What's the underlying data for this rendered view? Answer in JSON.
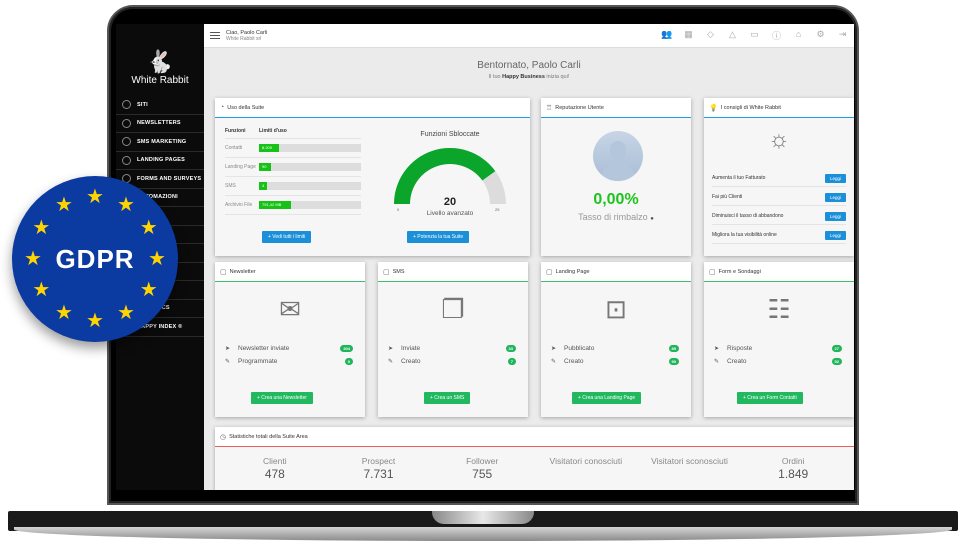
{
  "app": {
    "brand": "White Rabbit"
  },
  "header": {
    "greeting": "Ciao, Paolo Carli",
    "company": "White Rabbit srl",
    "icons": [
      "users-icon",
      "calendar-icon",
      "tag-icon",
      "bell-icon",
      "archive-icon",
      "help-icon",
      "lock-icon",
      "gear-icon",
      "logout-icon"
    ]
  },
  "sidebar": {
    "items": [
      {
        "label": "SITI",
        "icon": "globe-icon"
      },
      {
        "label": "NEWSLETTERS",
        "icon": "newsletter-icon"
      },
      {
        "label": "SMS MARKETING",
        "icon": "sms-icon"
      },
      {
        "label": "LANDING PAGES",
        "icon": "landing-icon"
      },
      {
        "label": "FORMS AND SURVEYS",
        "icon": "form-icon"
      },
      {
        "label": "AUTOMAZIONI",
        "icon": "automation-icon"
      },
      {
        "label": "",
        "icon": "item-icon"
      },
      {
        "label": "",
        "icon": "item-icon"
      },
      {
        "label": "",
        "icon": "item-icon"
      },
      {
        "label": "",
        "icon": "item-icon"
      },
      {
        "label": "",
        "icon": "item-icon"
      },
      {
        "label": "ANALYTICS",
        "icon": "analytics-icon"
      },
      {
        "label": "HAPPY INDEX ®",
        "icon": "happy-icon"
      }
    ]
  },
  "welcome": {
    "title": "Bentornato, Paolo Carli",
    "sub_pre": "Il tuo ",
    "sub_bold": "Happy Business",
    "sub_post": " inizia qui!"
  },
  "suite": {
    "title": "Uso della Suite",
    "col_func": "Funzioni",
    "col_limits": "Limiti d'uso",
    "rows": [
      {
        "label": "Contatti",
        "value": "8.209",
        "fraction": 0.2
      },
      {
        "label": "Landing Page",
        "value": "90",
        "fraction": 0.12
      },
      {
        "label": "SMS",
        "value": "4",
        "fraction": 0.08
      },
      {
        "label": "Archivio File",
        "value": "791,42 MB",
        "fraction": 0.31
      }
    ],
    "limits_button": "+ Vedi tutti i limiti",
    "gauge_title": "Funzioni Sbloccate",
    "gauge_value": 20,
    "gauge_min": 0,
    "gauge_max": 25,
    "gauge_label": "Livello avanzato",
    "upgrade_button": "+ Potenzia la tua Suite"
  },
  "reputation": {
    "title": "Reputazione Utente",
    "rate": "0,00%",
    "rate_label": "Tasso di rimbalzo"
  },
  "tips": {
    "title": "I consigli di White Rabbit",
    "items": [
      {
        "text": "Aumenta il tuo Fatturato",
        "button": "Leggi"
      },
      {
        "text": "Fai più Clienti",
        "button": "Leggi"
      },
      {
        "text": "Diminuisci il tasso di abbandono",
        "button": "Leggi"
      },
      {
        "text": "Migliora la tua visibilità online",
        "button": "Leggi"
      }
    ]
  },
  "modules": [
    {
      "title": "Newsletter",
      "rows": [
        {
          "label": "Newsletter inviate",
          "value": "204"
        },
        {
          "label": "Programmate",
          "value": "0"
        }
      ],
      "button": "+ Crea una Newsletter"
    },
    {
      "title": "SMS",
      "rows": [
        {
          "label": "Inviate",
          "value": "33"
        },
        {
          "label": "Creato",
          "value": "7"
        }
      ],
      "button": "+ Crea un SMS"
    },
    {
      "title": "Landing Page",
      "rows": [
        {
          "label": "Pubblicato",
          "value": "89"
        },
        {
          "label": "Creato",
          "value": "90"
        }
      ],
      "button": "+ Crea una Landing Page"
    },
    {
      "title": "Form e Sondaggi",
      "rows": [
        {
          "label": "Risposte",
          "value": "27"
        },
        {
          "label": "Creato",
          "value": "52"
        }
      ],
      "button": "+ Crea un Form Contatti"
    }
  ],
  "totals": {
    "title": "Statistiche totali della Suite Area",
    "items": [
      {
        "label": "Clienti",
        "value": "478"
      },
      {
        "label": "Prospect",
        "value": "7.731"
      },
      {
        "label": "Follower",
        "value": "755"
      },
      {
        "label": "Visitatori conosciuti",
        "value": ""
      },
      {
        "label": "Visitatori sconosciuti",
        "value": ""
      },
      {
        "label": "Ordini",
        "value": "1.849"
      }
    ]
  },
  "badge": {
    "text": "GDPR"
  },
  "colors": {
    "primary": "#1b8fd8",
    "success": "#22b860",
    "gauge": "#0aa52a",
    "accent_red": "#e9605d"
  }
}
